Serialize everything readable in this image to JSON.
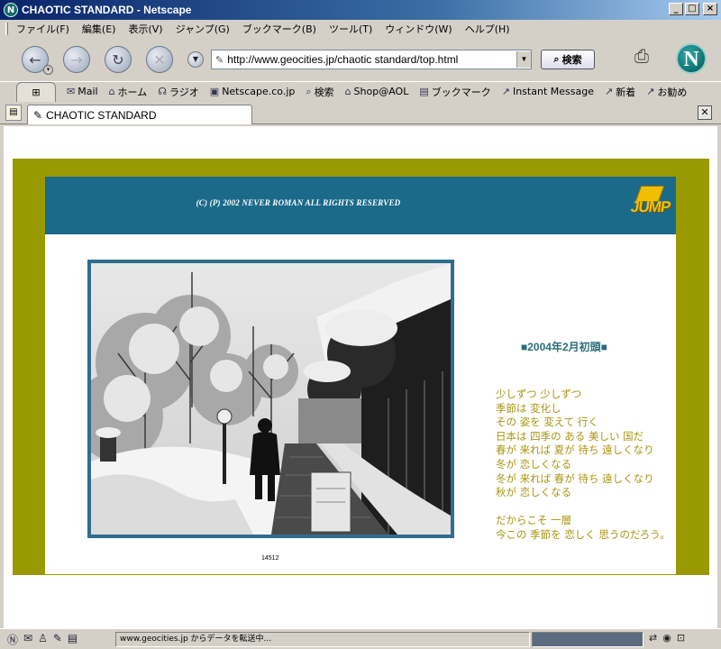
{
  "window": {
    "title": "CHAOTIC STANDARD - Netscape",
    "app_icon": "N"
  },
  "menu": [
    "ファイル(F)",
    "編集(E)",
    "表示(V)",
    "ジャンプ(G)",
    "ブックマーク(B)",
    "ツール(T)",
    "ウィンドウ(W)",
    "ヘルプ(H)"
  ],
  "navigation": {
    "url": "http://www.geocities.jp/chaotic standard/top.html",
    "search_label": "検索"
  },
  "personal_toolbar": [
    {
      "icon": "mail-icon",
      "glyph": "✉",
      "label": "Mail"
    },
    {
      "icon": "home-icon",
      "glyph": "⌂",
      "label": "ホーム"
    },
    {
      "icon": "radio-icon",
      "glyph": "☊",
      "label": "ラジオ"
    },
    {
      "icon": "mynetscape-icon",
      "glyph": "▣",
      "label": "Netscape.co.jp"
    },
    {
      "icon": "search-icon",
      "glyph": "⌕",
      "label": "検索"
    },
    {
      "icon": "shop-icon",
      "glyph": "⌂",
      "label": "Shop@AOL"
    },
    {
      "icon": "bookmark-icon",
      "glyph": "▤",
      "label": "ブックマーク"
    },
    {
      "icon": "bookmark-link-icon",
      "glyph": "↗",
      "label": "Instant Message"
    },
    {
      "icon": "bookmark-link-icon",
      "glyph": "↗",
      "label": "新着"
    },
    {
      "icon": "bookmark-link-icon",
      "glyph": "↗",
      "label": "お勧め"
    }
  ],
  "tab": {
    "title": "CHAOTIC STANDARD"
  },
  "page": {
    "copyright": "(C) (P) 2002 NEVER ROMAN ALL RIGHTS RESERVED",
    "logo_text": "JUMP",
    "counter": "14512",
    "date_heading": "■2004年2月初頭■",
    "poem_lines": [
      "少しずつ 少しずつ",
      "季節は 変化し",
      "その 姿を 変えて 行く",
      "日本は 四季の ある 美しい 国だ",
      "春が 来れば 夏が 待ち 遠しくなり",
      "冬が 恋しくなる",
      "冬が 来れば 春が 待ち 遠しくなり",
      "秋が 恋しくなる"
    ],
    "poem_closing": [
      "だからこそ 一層",
      "今この 季節を 恋しく 思うのだろう。"
    ]
  },
  "status": {
    "text": "www.geocities.jp からデータを転送中...",
    "progress": 1.0
  },
  "colors": {
    "olive_frame": "#999900",
    "banner": "#1b6a8a",
    "poem_text": "#a89510",
    "date_text": "#2a6e7a"
  }
}
